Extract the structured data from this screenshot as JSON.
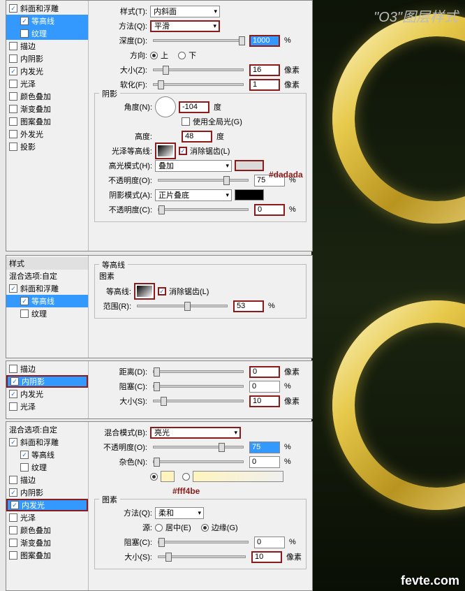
{
  "header_title": "\"O3\"图层样式",
  "annotations": {
    "dadada": "#dadada",
    "fff4be": "#fff4be"
  },
  "watermark": "fevte.com",
  "colors": {
    "highlight_border": "#8b1a1a",
    "swatch_dadada": "#dadada",
    "swatch_fff4be": "#fff4be"
  },
  "panel1": {
    "sidebar": [
      {
        "label": "斜面和浮雕",
        "checked": true,
        "selected": false
      },
      {
        "label": "等高线",
        "checked": true,
        "selected": true,
        "sub": true
      },
      {
        "label": "纹理",
        "checked": false,
        "selected": true,
        "sub": true
      },
      {
        "label": "描边",
        "checked": false
      },
      {
        "label": "内阴影",
        "checked": false
      },
      {
        "label": "内发光",
        "checked": true
      },
      {
        "label": "光泽",
        "checked": false
      },
      {
        "label": "颜色叠加",
        "checked": false
      },
      {
        "label": "渐变叠加",
        "checked": false
      },
      {
        "label": "图案叠加",
        "checked": false
      },
      {
        "label": "外发光",
        "checked": false
      },
      {
        "label": "投影",
        "checked": false
      }
    ],
    "style_label": "样式(T):",
    "style_value": "内斜面",
    "method_label": "方法(Q):",
    "method_value": "平滑",
    "depth_label": "深度(D):",
    "depth_value": "1000",
    "depth_unit": "%",
    "direction_label": "方向:",
    "up": "上",
    "down": "下",
    "size_label": "大小(Z):",
    "size_value": "16",
    "size_unit": "像素",
    "soften_label": "软化(F):",
    "soften_value": "1",
    "soften_unit": "像素",
    "shadow_group": "阴影",
    "angle_label": "角度(N):",
    "angle_value": "-104",
    "angle_unit": "度",
    "global_label": "使用全局光(G)",
    "altitude_label": "高度:",
    "altitude_value": "48",
    "altitude_unit": "度",
    "gloss_label": "光泽等高线:",
    "antialias_label": "消除锯齿(L)",
    "highlight_mode_label": "高光模式(H):",
    "highlight_mode_value": "叠加",
    "opacity1_label": "不透明度(O):",
    "opacity1_value": "75",
    "opacity1_unit": "%",
    "shadow_mode_label": "阴影模式(A):",
    "shadow_mode_value": "正片叠底",
    "opacity2_label": "不透明度(C):",
    "opacity2_value": "0",
    "opacity2_unit": "%"
  },
  "panel2": {
    "sidebar_header": "样式",
    "blend_options": "混合选项:自定",
    "sidebar": [
      {
        "label": "斜面和浮雕",
        "checked": true
      },
      {
        "label": "等高线",
        "checked": true,
        "selected": true,
        "sub": true
      },
      {
        "label": "纹理",
        "checked": false,
        "sub": true
      }
    ],
    "contour_group": "等高线",
    "elements_group": "图素",
    "contour_label": "等高线:",
    "antialias_label": "消除锯齿(L)",
    "range_label": "范围(R):",
    "range_value": "53",
    "range_unit": "%"
  },
  "panel3": {
    "sidebar": [
      {
        "label": "描边",
        "checked": false
      },
      {
        "label": "内阴影",
        "checked": true,
        "red": true
      },
      {
        "label": "内发光",
        "checked": true
      },
      {
        "label": "光泽",
        "checked": false
      }
    ],
    "distance_label": "距离(D):",
    "distance_value": "0",
    "distance_unit": "像素",
    "choke_label": "阻塞(C):",
    "choke_value": "0",
    "choke_unit": "%",
    "size_label": "大小(S):",
    "size_value": "10",
    "size_unit": "像素"
  },
  "panel4": {
    "blend_options": "混合选项:自定",
    "sidebar": [
      {
        "label": "斜面和浮雕",
        "checked": true
      },
      {
        "label": "等高线",
        "checked": true,
        "sub": true
      },
      {
        "label": "纹理",
        "checked": false,
        "sub": true
      },
      {
        "label": "描边",
        "checked": false
      },
      {
        "label": "内阴影",
        "checked": true
      },
      {
        "label": "内发光",
        "checked": true,
        "red": true
      },
      {
        "label": "光泽",
        "checked": false
      },
      {
        "label": "颜色叠加",
        "checked": false
      },
      {
        "label": "渐变叠加",
        "checked": false
      },
      {
        "label": "图案叠加",
        "checked": false
      }
    ],
    "blend_mode_label": "混合模式(B):",
    "blend_mode_value": "亮光",
    "opacity_label": "不透明度(O):",
    "opacity_value": "75",
    "opacity_unit": "%",
    "noise_label": "杂色(N):",
    "noise_value": "0",
    "noise_unit": "%",
    "elements_group": "图素",
    "method_label": "方法(Q):",
    "method_value": "柔和",
    "source_label": "源:",
    "center": "居中(E)",
    "edge": "边缘(G)",
    "choke_label": "阻塞(C):",
    "choke_value": "0",
    "choke_unit": "%",
    "size_label": "大小(S):",
    "size_value": "10",
    "size_unit": "像素"
  }
}
